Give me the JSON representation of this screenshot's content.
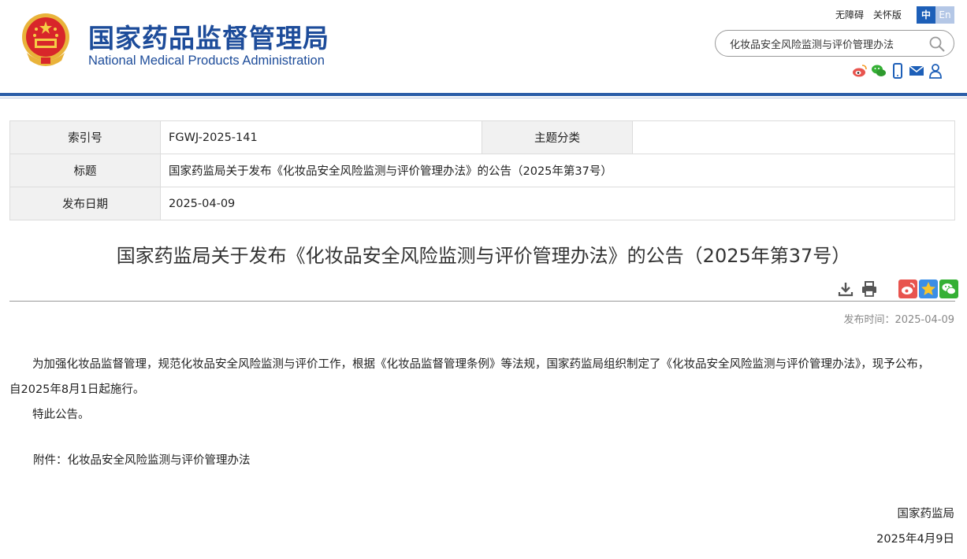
{
  "header": {
    "site_name_cn": "国家药品监督管理局",
    "site_name_en": "National Medical Products Administration",
    "links": {
      "accessibility": "无障碍",
      "elderly": "关怀版"
    },
    "lang": {
      "zh": "中",
      "en": "En"
    },
    "search": {
      "value": "化妆品安全风险监测与评价管理办法"
    },
    "social_icons": [
      "weibo-icon",
      "wechat-icon",
      "mobile-icon",
      "mail-icon",
      "user-icon"
    ]
  },
  "meta": {
    "index_label": "索引号",
    "index_value": "FGWJ-2025-141",
    "category_label": "主题分类",
    "category_value": "",
    "title_label": "标题",
    "title_value": "国家药监局关于发布《化妆品安全风险监测与评价管理办法》的公告（2025年第37号）",
    "date_label": "发布日期",
    "date_value": "2025-04-09"
  },
  "article": {
    "title": "国家药监局关于发布《化妆品安全风险监测与评价管理办法》的公告（2025年第37号）",
    "tools": [
      "download-icon",
      "print-icon",
      "share-weibo-icon",
      "share-qzone-icon",
      "share-wechat-icon"
    ],
    "publish_time": "发布时间：2025-04-09",
    "paragraph1": "为加强化妆品监督管理，规范化妆品安全风险监测与评价工作，根据《化妆品监督管理条例》等法规，国家药监局组织制定了《化妆品安全风险监测与评价管理办法》，现予公布，自2025年8月1日起施行。",
    "paragraph2": "特此公告。",
    "attachment": "附件：化妆品安全风险监测与评价管理办法",
    "signature_org": "国家药监局",
    "signature_date": "2025年4月9日"
  },
  "colors": {
    "brand_blue": "#1d4c9a",
    "rule_blue": "#2b5ea8",
    "weibo_red": "#e8544e",
    "wechat_green": "#35b035"
  }
}
